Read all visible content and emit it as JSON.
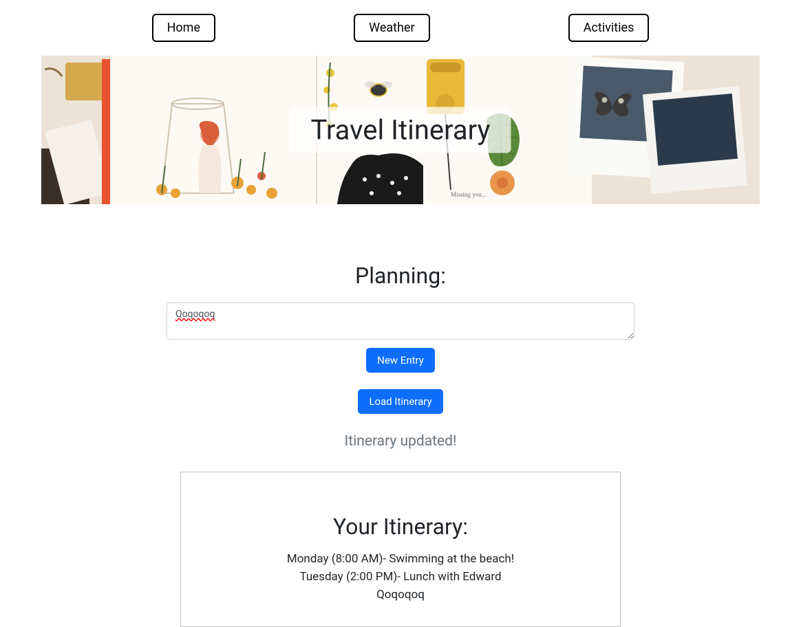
{
  "nav": {
    "home": "Home",
    "weather": "Weather",
    "activities": "Activities"
  },
  "hero": {
    "title": "Travel Itinerary"
  },
  "planning": {
    "heading": "Planning:",
    "textarea_value": "Qoqoqoq",
    "new_entry_label": "New Entry",
    "load_itinerary_label": "Load Itinerary"
  },
  "status": {
    "message": "Itinerary updated!"
  },
  "itinerary": {
    "heading": "Your Itinerary:",
    "items": [
      "Monday (8:00 AM)- Swimming at the beach!",
      "Tuesday (2:00 PM)- Lunch with Edward",
      "Qoqoqoq"
    ]
  }
}
